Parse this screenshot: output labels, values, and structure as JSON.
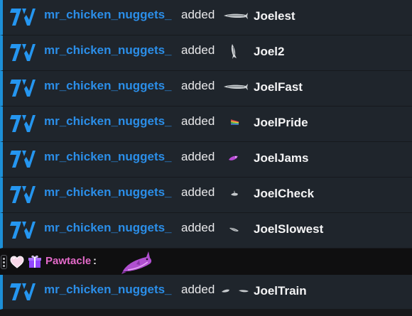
{
  "chat": {
    "messages": [
      {
        "username": "mr_chicken_nuggets_",
        "verb": "added",
        "emote_icon": "long-silver-fish-emote",
        "emote_name": "Joelest"
      },
      {
        "username": "mr_chicken_nuggets_",
        "verb": "added",
        "emote_icon": "vertical-fish-emote",
        "emote_name": "Joel2"
      },
      {
        "username": "mr_chicken_nuggets_",
        "verb": "added",
        "emote_icon": "long-silver-fish-emote",
        "emote_name": "JoelFast"
      },
      {
        "username": "mr_chicken_nuggets_",
        "verb": "added",
        "emote_icon": "rainbow-fish-emote",
        "emote_name": "JoelPride"
      },
      {
        "username": "mr_chicken_nuggets_",
        "verb": "added",
        "emote_icon": "purple-fish-emote",
        "emote_name": "JoelJams"
      },
      {
        "username": "mr_chicken_nuggets_",
        "verb": "added",
        "emote_icon": "small-silver-fish-emote",
        "emote_name": "JoelCheck"
      },
      {
        "username": "mr_chicken_nuggets_",
        "verb": "added",
        "emote_icon": "small-silver-fish-emote",
        "emote_name": "JoelSlowest"
      }
    ],
    "user_message": {
      "badges": [
        "heart-badge-icon",
        "gift-badge-icon"
      ],
      "username": "Pawtacle",
      "colon": ":",
      "emote_icon": "purple-shark-emote"
    },
    "last_message": {
      "username": "mr_chicken_nuggets_",
      "verb": "added",
      "emote_icon": "two-small-fish-emote",
      "emote_name": "JoelTrain"
    }
  },
  "colors": {
    "system_row_bg": "#1f252c",
    "accent_bar": "#1d90d8",
    "username_blue": "#2b8ee8",
    "username_pink": "#e36ac9",
    "chat_bg": "#0f0f10"
  }
}
